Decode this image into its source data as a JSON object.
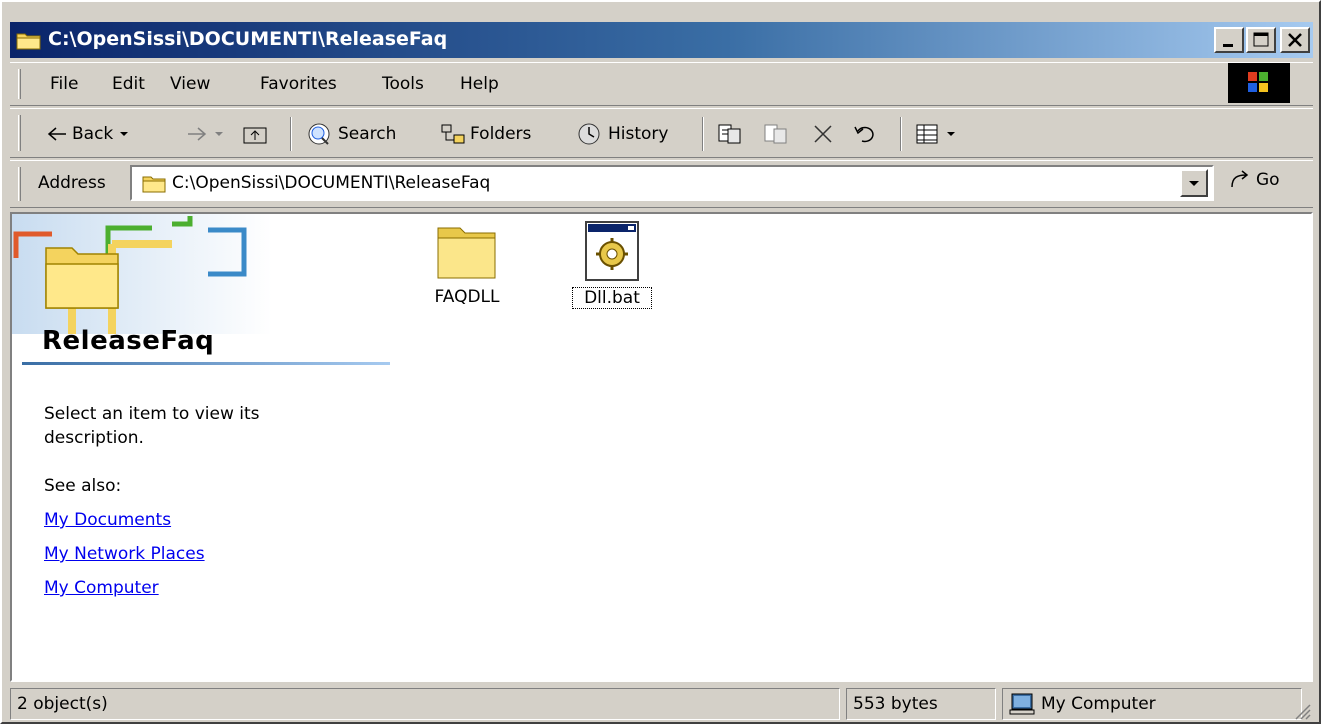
{
  "window": {
    "title": "C:\\OpenSissi\\DOCUMENTI\\ReleaseFaq"
  },
  "menu": [
    "File",
    "Edit",
    "View",
    "Favorites",
    "Tools",
    "Help"
  ],
  "toolbar": {
    "back": "Back",
    "search": "Search",
    "folders": "Folders",
    "history": "History"
  },
  "address": {
    "label": "Address",
    "value": "C:\\OpenSissi\\DOCUMENTI\\ReleaseFaq",
    "go": "Go"
  },
  "left_pane": {
    "folder_name": "ReleaseFaq",
    "description": "Select an item to view its description.",
    "see_also": "See also:",
    "links": [
      "My Documents",
      "My Network Places",
      "My Computer"
    ]
  },
  "files": [
    {
      "name": "FAQDLL",
      "icon": "folder-icon"
    },
    {
      "name": "Dll.bat",
      "icon": "batch-file-icon"
    }
  ],
  "status": {
    "objects": "2 object(s)",
    "size": "553 bytes",
    "zone": "My Computer"
  },
  "colors": {
    "title_start": "#0a246a",
    "title_end": "#a6caf0",
    "face": "#d4d0c8",
    "link": "#0000ee"
  }
}
